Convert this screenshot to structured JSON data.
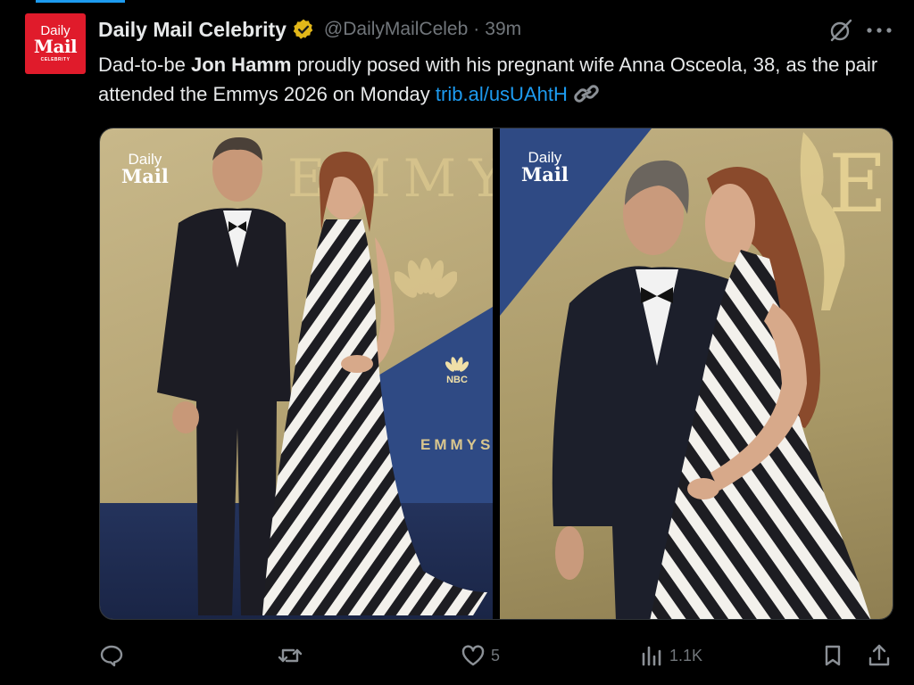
{
  "tweet": {
    "author": {
      "display_name": "Daily Mail Celebrity",
      "handle": "@DailyMailCeleb",
      "separator": "·",
      "time": "39m",
      "avatar_text": {
        "line1": "Daily",
        "line2": "Mail",
        "line3": "CELEBRITY"
      }
    },
    "text": {
      "part1": "Dad-to-be ",
      "bold_name": "Jon Hamm",
      "part2": " proudly posed with his pregnant wife Anna Osceola, 38, as the pair attended the Emmys 2026 on Monday ",
      "link": "trib.al/usUAhtH"
    },
    "media": {
      "photo_left": {
        "watermark": {
          "line1": "Daily",
          "line2": "Mail"
        },
        "backdrop_text": "EMMY",
        "nbc_label": "NBC",
        "emmys_label": "EMMYS"
      },
      "photo_right": {
        "watermark": {
          "line1": "Daily",
          "line2": "Mail"
        },
        "backdrop_text": "E"
      }
    },
    "actions": {
      "reply_count": "",
      "retweet_count": "",
      "like_count": "5",
      "views_count": "1.1K"
    },
    "colors": {
      "background": "#000000",
      "text": "#e7e9ea",
      "muted": "#71767b",
      "link": "#1d9bf0",
      "verified_badge": "#e2b719",
      "avatar_red": "#e01b2b"
    },
    "icons": [
      "verified-badge-icon",
      "grok-icon",
      "more-icon",
      "link-icon",
      "reply-icon",
      "retweet-icon",
      "like-icon",
      "views-icon",
      "bookmark-icon",
      "share-icon"
    ]
  }
}
